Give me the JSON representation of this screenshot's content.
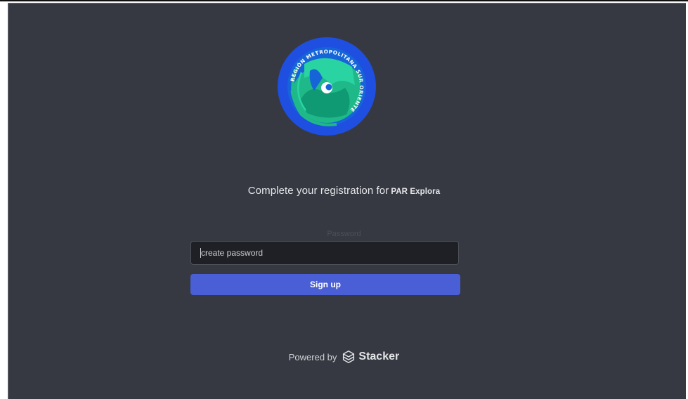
{
  "logo": {
    "text": "REGIÓN METROPOLITANA SUR ORIENTE",
    "colors": {
      "ring": "#1f4fe0",
      "inner": "#1565d8",
      "green": "#1fb889",
      "teal": "#2ad3a2"
    }
  },
  "registration": {
    "prompt": "Complete your registration for",
    "app_name": "PAR Explora"
  },
  "password": {
    "label": "Password",
    "placeholder": "create password",
    "value": ""
  },
  "signup": {
    "label": "Sign up",
    "color": "#4a5fd5"
  },
  "footer": {
    "powered_by": "Powered by",
    "brand": "Stacker",
    "icon": "stacker-logo-icon"
  }
}
